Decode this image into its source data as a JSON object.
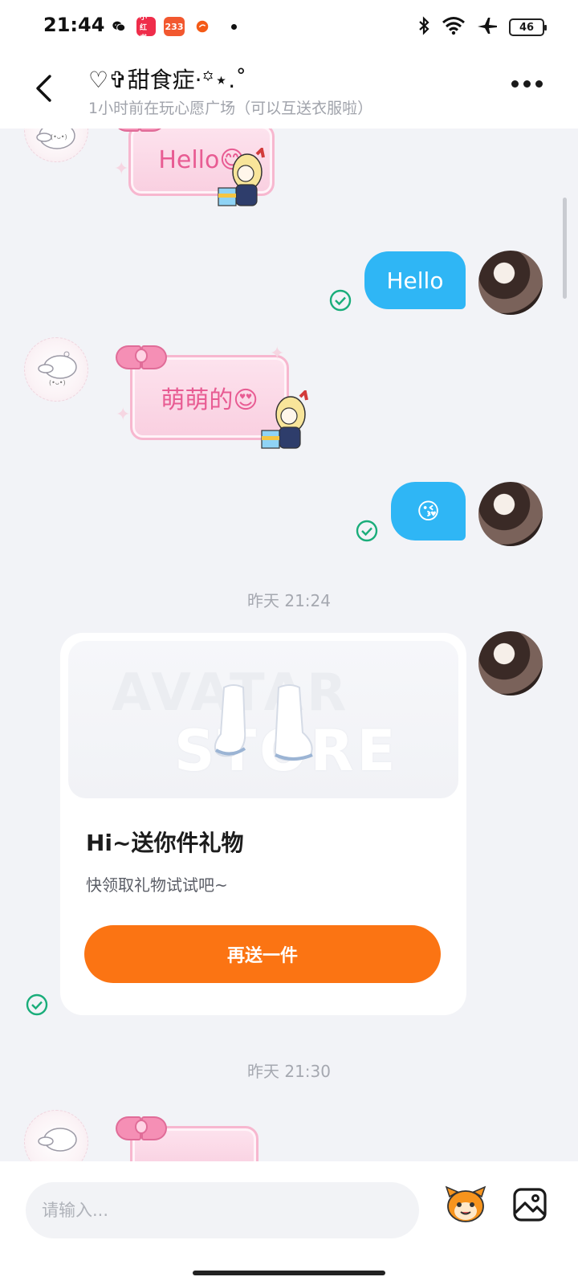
{
  "status_bar": {
    "time": "21:44",
    "apps": [
      "wechat-icon",
      "xiaohongshu-icon",
      "233-icon",
      "taobao-icon"
    ],
    "app_233_label": "233",
    "app_xhs_label": "小红书",
    "battery": "46"
  },
  "header": {
    "title": "♡✞甜食症·꙳⋆.˚",
    "subtitle": "1小时前在玩心愿广场（可以互送衣服啦）"
  },
  "messages": {
    "m1_text": "Hello😋",
    "m2_text": "Hello",
    "m3_text": "萌萌的😍",
    "m4_text": "😘"
  },
  "timestamps": {
    "t1": "昨天 21:24",
    "t2": "昨天 21:30"
  },
  "gift_card": {
    "watermark_line1": "AVATAR",
    "watermark_line2": "STORE",
    "title": "Hi~送你件礼物",
    "subtitle": "快领取礼物试试吧~",
    "button_label": "再送一件"
  },
  "input": {
    "placeholder": "请输入..."
  },
  "colors": {
    "outgoing_bubble": "#2fb6f5",
    "accent_orange": "#fb7413",
    "read_check": "#1aad7a",
    "sticker_pink": "#e85c93"
  }
}
